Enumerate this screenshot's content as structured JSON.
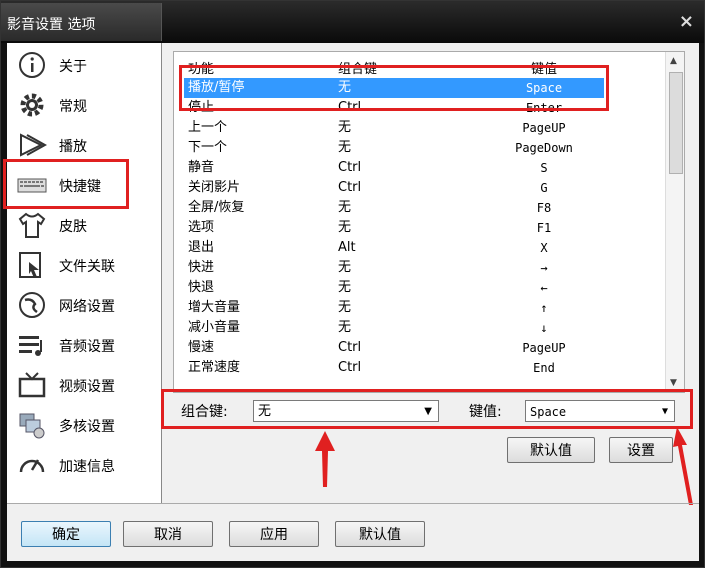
{
  "window": {
    "title": "影音设置 选项",
    "close_glyph": "×"
  },
  "sidebar": {
    "items": [
      {
        "label": "关于",
        "icon": "info-icon"
      },
      {
        "label": "常规",
        "icon": "gear-icon"
      },
      {
        "label": "播放",
        "icon": "play-icon"
      },
      {
        "label": "快捷键",
        "icon": "keyboard-icon"
      },
      {
        "label": "皮肤",
        "icon": "shirt-icon"
      },
      {
        "label": "文件关联",
        "icon": "file-association-icon"
      },
      {
        "label": "网络设置",
        "icon": "network-icon"
      },
      {
        "label": "音频设置",
        "icon": "audio-icon"
      },
      {
        "label": "视频设置",
        "icon": "tv-icon"
      },
      {
        "label": "多核设置",
        "icon": "multicore-icon"
      },
      {
        "label": "加速信息",
        "icon": "speedometer-icon"
      }
    ]
  },
  "shortcut_list": {
    "headers": [
      "功能",
      "组合键",
      "键值"
    ],
    "rows": [
      [
        "播放/暂停",
        "无",
        "Space"
      ],
      [
        "停止",
        "Ctrl",
        "Enter"
      ],
      [
        "上一个",
        "无",
        "PageUP"
      ],
      [
        "下一个",
        "无",
        "PageDown"
      ],
      [
        "静音",
        "Ctrl",
        "S"
      ],
      [
        "关闭影片",
        "Ctrl",
        "G"
      ],
      [
        "全屏/恢复",
        "无",
        "F8"
      ],
      [
        "选项",
        "无",
        "F1"
      ],
      [
        "退出",
        "Alt",
        "X"
      ],
      [
        "快进",
        "无",
        "→"
      ],
      [
        "快退",
        "无",
        "←"
      ],
      [
        "增大音量",
        "无",
        "↑"
      ],
      [
        "减小音量",
        "无",
        "↓"
      ],
      [
        "慢速",
        "Ctrl",
        "PageUP"
      ],
      [
        "正常速度",
        "Ctrl",
        "End"
      ]
    ],
    "selected_index": 0
  },
  "editor": {
    "modifier_label": "组合键:",
    "modifier_value": "无",
    "key_label": "键值:",
    "key_value": "Space",
    "default_button": "默认值",
    "set_button": "设置"
  },
  "footer": {
    "ok": "确定",
    "cancel": "取消",
    "apply": "应用",
    "defaults": "默认值"
  },
  "colors": {
    "highlight": "#e02020",
    "selection": "#3399ff"
  }
}
